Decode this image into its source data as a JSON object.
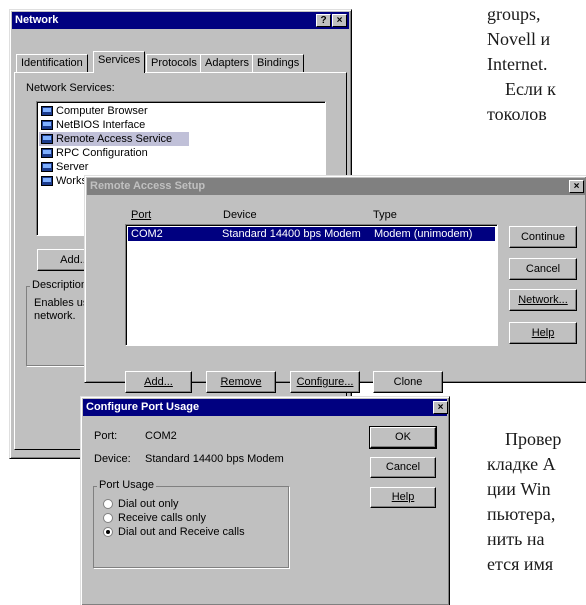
{
  "background_text": {
    "top": [
      "groups,",
      "Novell и",
      "Internet.",
      "Если к",
      "токолов"
    ],
    "bottom": [
      "Провер",
      "кладке А",
      "ции Win",
      "пьютера,",
      "нить на",
      "ется имя"
    ]
  },
  "network_window": {
    "title": "Network",
    "help_btn": "?",
    "close_btn": "×",
    "tabs": [
      "Identification",
      "Services",
      "Protocols",
      "Adapters",
      "Bindings"
    ],
    "services_label": "Network Services:",
    "services": [
      "Computer Browser",
      "NetBIOS Interface",
      "Remote Access Service",
      "RPC Configuration",
      "Server",
      "Workstatio"
    ],
    "add_button": "Add...",
    "description_label": "Description:",
    "description_text": "Enables users network."
  },
  "remote_access_window": {
    "title": "Remote Access Setup",
    "close_btn": "×",
    "columns": [
      "Port",
      "Device",
      "Type"
    ],
    "rows": [
      {
        "port": "COM2",
        "device": "Standard 14400 bps Modem",
        "type": "Modem (unimodem)"
      }
    ],
    "side_buttons": [
      "Continue",
      "Cancel",
      "Network...",
      "Help"
    ],
    "bottom_buttons": [
      "Add...",
      "Remove",
      "Configure...",
      "Clone"
    ]
  },
  "port_usage_window": {
    "title": "Configure Port Usage",
    "close_btn": "×",
    "port_label": "Port:",
    "port_value": "COM2",
    "device_label": "Device:",
    "device_value": "Standard 14400 bps Modem",
    "buttons": [
      "OK",
      "Cancel",
      "Help"
    ],
    "group_label": "Port Usage",
    "options": [
      "Dial out only",
      "Receive calls only",
      "Dial out and Receive calls"
    ],
    "selected_option": 2
  }
}
